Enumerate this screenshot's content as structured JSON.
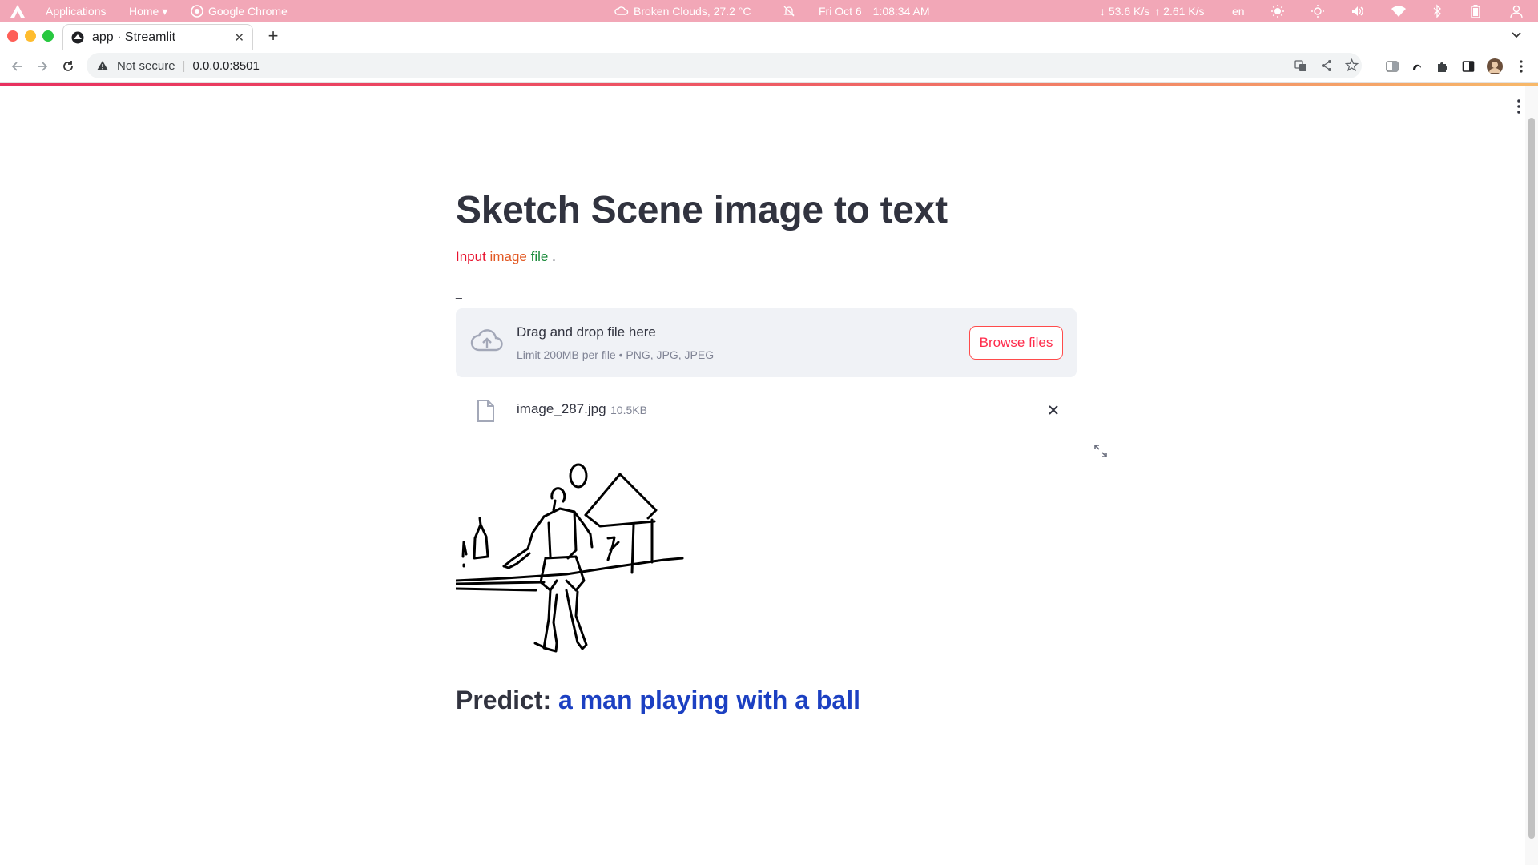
{
  "os_bar": {
    "applications": "Applications",
    "home": "Home ▾",
    "active_app": "Google Chrome",
    "weather": "Broken Clouds, 27.2 °C",
    "date": "Fri Oct 6",
    "time": "1:08:34 AM",
    "net_down": "↓ 53.6 K/s",
    "net_up": "↑ 2.61 K/s",
    "lang": "en"
  },
  "browser": {
    "tab_title": "app · Streamlit",
    "security_label": "Not secure",
    "url": "0.0.0.0:8501"
  },
  "app": {
    "title": "Sketch Scene image to text",
    "subtitle_words": [
      "Input",
      "image",
      "file",
      "."
    ],
    "underscore": "_",
    "uploader": {
      "title": "Drag and drop file here",
      "limits": "Limit 200MB per file • PNG, JPG, JPEG",
      "browse_label": "Browse files"
    },
    "file": {
      "name": "image_287.jpg",
      "size": "10.5KB"
    },
    "predict_label": "Predict:",
    "predict_value": "a man playing with a ball"
  },
  "colors": {
    "os_bar": "#f2a7b7",
    "accent": "#ff4b4b",
    "predict_value": "#1c40c2"
  }
}
